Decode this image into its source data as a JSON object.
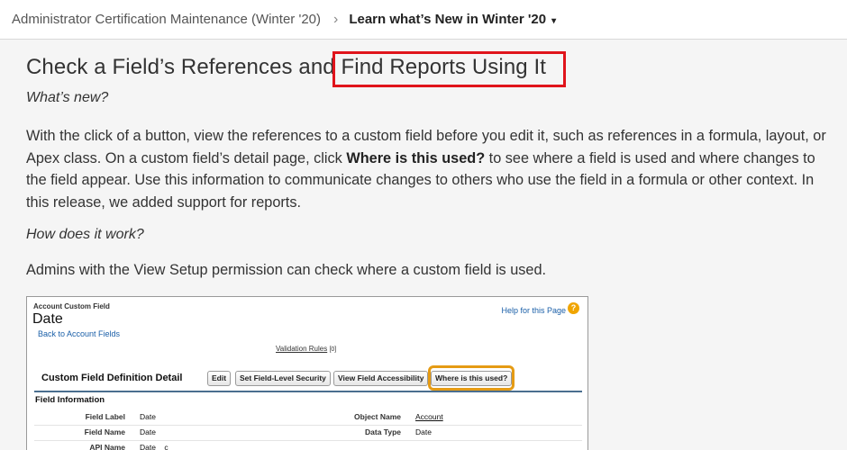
{
  "breadcrumb": {
    "parent": "Administrator Certification Maintenance (Winter '20)",
    "separator": "›",
    "current": "Learn what’s New in Winter '20",
    "caret": "▾"
  },
  "article": {
    "title_part1": "Check a Field’s References and ",
    "title_part2": "Find Reports Using It",
    "whats_new": "What’s new?",
    "para_1": "With the click of a button, view the references to a custom field before you edit it, such as references in a formula, layout, or Apex class. On a custom field’s detail page, click ",
    "para_bold": "Where is this used?",
    "para_2": " to see where a field is used and where changes to the field appear. Use this information to communicate changes to others who use the field in a formula or other context. In this release, we added support for reports.",
    "how_does": "How does it work?",
    "admins": "Admins with the View Setup permission can check where a custom field is used."
  },
  "screenshot": {
    "object_label": "Account Custom Field",
    "field_title": "Date",
    "back_link": "Back to Account Fields",
    "help_link": "Help for this Page",
    "help_icon": "?",
    "validation_link": "Validation Rules",
    "validation_count": "[0]",
    "section_title": "Custom Field Definition Detail",
    "buttons": {
      "edit": "Edit",
      "fls": "Set Field-Level Security",
      "accessibility": "View Field Accessibility",
      "where_used": "Where is this used?"
    },
    "field_info_heading": "Field Information",
    "rows": {
      "field_label": {
        "label": "Field Label",
        "value": "Date"
      },
      "object_name": {
        "label": "Object Name",
        "value": "Account"
      },
      "field_name": {
        "label": "Field Name",
        "value": "Date"
      },
      "data_type": {
        "label": "Data Type",
        "value": "Date"
      },
      "api_name": {
        "label": "API Name",
        "value": "Date__c"
      }
    }
  },
  "colors": {
    "highlight_red": "#e0141b",
    "highlight_orange": "#e59b14",
    "link_blue": "#1a5fa8",
    "page_bg": "#f5f5f5"
  }
}
